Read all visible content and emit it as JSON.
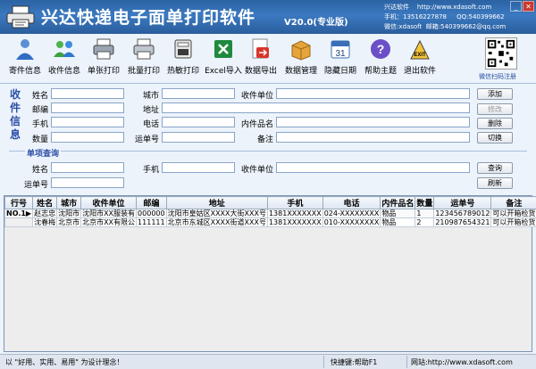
{
  "app": {
    "title": "兴达快递电子面单打印软件",
    "version": "V20.0(专业版)",
    "contact": "兴达软件    http://www.xdasoft.com\n手机：13516227878     QQ:540399662\n微信:xdasoft  邮箱:540399662@qq.com"
  },
  "toolbar": {
    "items": [
      {
        "label": "寄件信息",
        "icon": "users-icon"
      },
      {
        "label": "收件信息",
        "icon": "group-icon"
      },
      {
        "label": "单张打印",
        "icon": "printer-icon"
      },
      {
        "label": "批量打印",
        "icon": "printer-icon"
      },
      {
        "label": "热敏打印",
        "icon": "thermal-printer-icon"
      },
      {
        "label": "Excel导入",
        "icon": "excel-icon"
      },
      {
        "label": "数据导出",
        "icon": "export-icon"
      },
      {
        "label": "数据管理",
        "icon": "box-icon"
      },
      {
        "label": "隐藏日期",
        "icon": "calendar-icon"
      },
      {
        "label": "帮助主题",
        "icon": "help-icon"
      },
      {
        "label": "退出软件",
        "icon": "exit-icon"
      }
    ],
    "calendar_day": "31",
    "exit_text": "EXIT",
    "qr_label": "微信扫码注册"
  },
  "sender": {
    "section_title": "收件信息",
    "fields": {
      "name": "姓名",
      "city": "城市",
      "recv_unit": "收件单位",
      "zip": "邮编",
      "address": "地址",
      "phone": "手机",
      "tel": "电话",
      "item_name": "内件品名",
      "qty": "数量",
      "tracking": "运单号",
      "note": "备注"
    },
    "buttons": {
      "add": "添加",
      "modify": "修改",
      "delete": "删除",
      "switch": "切换"
    }
  },
  "search": {
    "section_title": "单项查询",
    "fields": {
      "name": "姓名",
      "phone": "手机",
      "recv_unit": "收件单位",
      "tracking": "运单号"
    },
    "buttons": {
      "query": "查询",
      "refresh": "刷新"
    }
  },
  "table": {
    "headers": [
      "行号",
      "姓名",
      "城市",
      "收件单位",
      "邮编",
      "地址",
      "手机",
      "电话",
      "内件品名",
      "数量",
      "运单号",
      "备注"
    ],
    "rows": [
      [
        "NO.1▶",
        "赵志忠",
        "沈阳市",
        "沈阳市XX服装有",
        "000000",
        "沈阳市皇姑区XXXX大街XXX号",
        "1381XXXXXXX",
        "024-XXXXXXXX",
        "物品",
        "1",
        "123456789012",
        "可以开箱检货"
      ],
      [
        "",
        "沈春梅",
        "北京市",
        "北京市XX有限公",
        "111111",
        "北京市东城区XXXX街道XXX号",
        "1381XXXXXXX",
        "010-XXXXXXXX",
        "物品",
        "2",
        "210987654321",
        "可以开箱检货"
      ]
    ]
  },
  "status": {
    "slogan": "以 \"好用、实用、易用\" 为设计理念！",
    "hotkey": "快捷键:帮助F1",
    "website": "网站:http://www.xdasoft.com"
  },
  "colors": {
    "title_bar": "#2c63a3",
    "section_title": "#2d4fa8",
    "panel_bg": "#ecf3fb"
  }
}
